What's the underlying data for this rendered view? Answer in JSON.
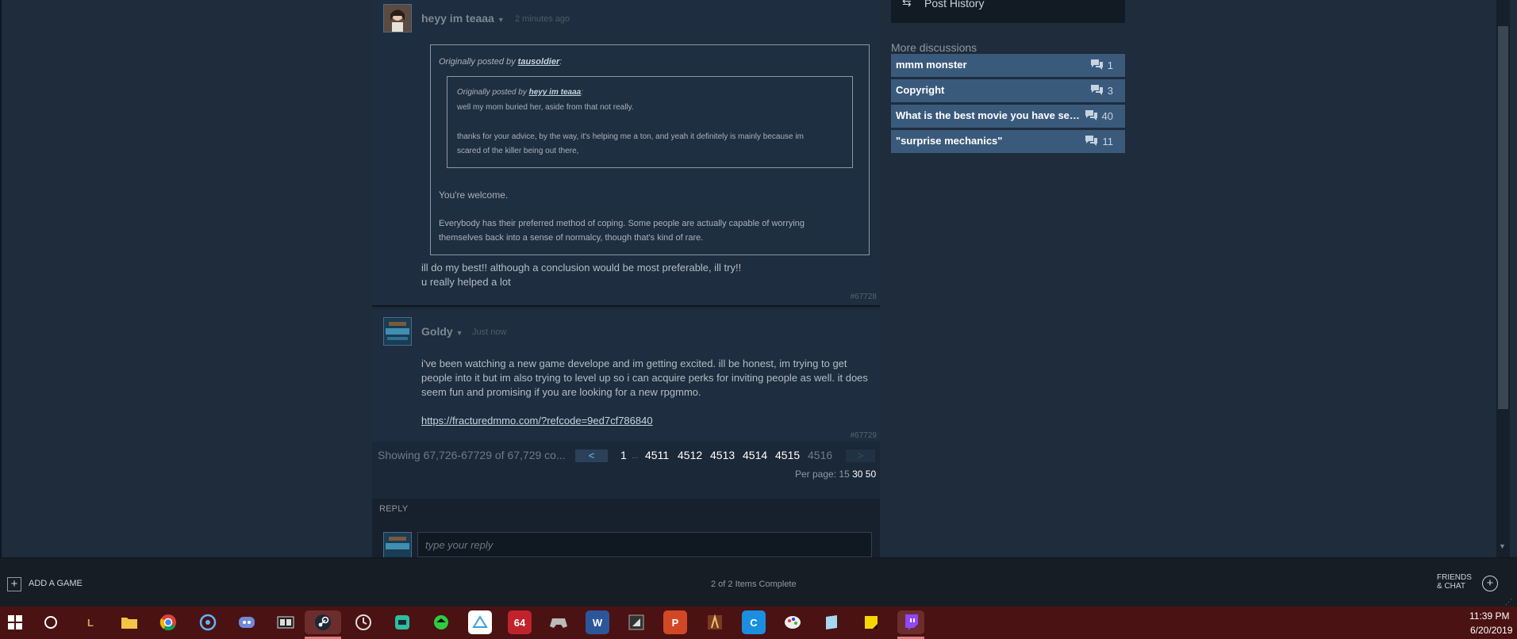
{
  "thread": {
    "post1": {
      "author": "heyy im teaaa",
      "time": "2 minutes ago",
      "quote_outer_header_prefix": "Originally posted by ",
      "quote_outer_author": "tausoldier",
      "quote_inner_header_prefix": "Originally posted by ",
      "quote_inner_author": "heyy im teaaa",
      "quote_inner_line1": "well my mom buried her, aside from that not really.",
      "quote_inner_line2": "thanks for your advice, by the way, it's helping me a ton, and yeah it definitely is mainly because im",
      "quote_inner_line3": "scared of the killer being out there,",
      "quote_outer_line1": "You're welcome.",
      "quote_outer_line2": "Everybody has their preferred method of coping. Some people are actually capable of worrying",
      "quote_outer_line3": "themselves back into a sense of normalcy, though that's kind of rare.",
      "body_line1": "ill do my best!! although a conclusion would be most preferable, ill try!!",
      "body_line2": "u really helped a lot",
      "number": "#67728"
    },
    "post2": {
      "author": "Goldy",
      "time": "Just now",
      "body_line1": "i've been watching a new game develope and im getting excited. ill be honest, im trying to get",
      "body_line2": "people into it but im also trying to level up so i can acquire perks for inviting people as well. it does",
      "body_line3": "seem fun and promising if you are looking for a new rpgmmo.",
      "link": "https://fracturedmmo.com/?refcode=9ed7cf786840",
      "number": "#67729"
    }
  },
  "paging": {
    "summary": "Showing 67,726-67729 of 67,729 co...",
    "prev": "<",
    "next": ">",
    "first": "1",
    "ellipsis": "...",
    "pages": [
      "4511",
      "4512",
      "4513",
      "4514",
      "4515"
    ],
    "current": "4516",
    "per_page_label": "Per page:",
    "per_page_options": [
      "15",
      "30",
      "50"
    ]
  },
  "reply": {
    "label": "REPLY",
    "placeholder": "type your reply"
  },
  "sidebar": {
    "post_history": "Post History",
    "more_title": "More discussions",
    "discussions": [
      {
        "title": "mmm monster",
        "count": "1"
      },
      {
        "title": "Copyright",
        "count": "3"
      },
      {
        "title": "What is the best movie you have seen?",
        "count": "40"
      },
      {
        "title": "\"surprise mechanics\"",
        "count": "11"
      }
    ]
  },
  "steam_bar": {
    "add_game": "ADD A GAME",
    "status": "2 of 2 Items Complete",
    "friends_line1": "FRIENDS",
    "friends_line2": "& CHAT"
  },
  "taskbar": {
    "time": "11:39 PM",
    "date": "6/20/2019",
    "apps": [
      "league-of-legends",
      "file-explorer",
      "chrome",
      "battlenet",
      "discord",
      "video-editor",
      "steam",
      "clock-app",
      "game-app",
      "green-app",
      "drive",
      "n64-emulator",
      "game-controller",
      "word",
      "gamemaker",
      "powerpoint",
      "game-char",
      "ccleaner",
      "paint-app",
      "notes-app",
      "sticky-notes",
      "twitch"
    ],
    "n64_label": "64",
    "word_label": "W",
    "ppt_label": "P"
  },
  "colors": {
    "page_bg": "#1f2c3c",
    "post_bg": "#1e2d3f",
    "discussion_bg": "#3a5a7c",
    "taskbar_bg": "#4a1212",
    "link": "#c6d4df"
  }
}
